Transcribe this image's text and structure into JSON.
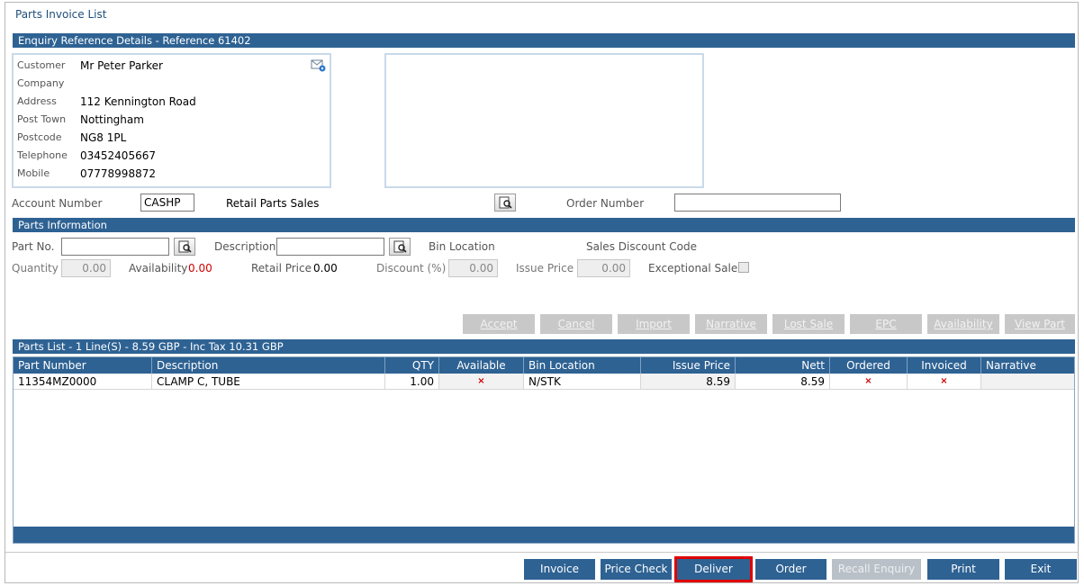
{
  "page": {
    "title": "Parts Invoice List"
  },
  "enquiry": {
    "bar_title": "Enquiry Reference Details  -  Reference 61402",
    "customer_label": "Customer",
    "customer": "Mr Peter Parker",
    "company_label": "Company",
    "company": "",
    "address_label": "Address",
    "address": "112 Kennington Road",
    "post_town_label": "Post Town",
    "post_town": "Nottingham",
    "postcode_label": "Postcode",
    "postcode": "NG8 1PL",
    "telephone_label": "Telephone",
    "telephone": "03452405667",
    "mobile_label": "Mobile",
    "mobile": "07778998872",
    "account_number_label": "Account Number",
    "account_number": "CASHP",
    "account_type": "Retail Parts Sales",
    "order_number_label": "Order Number",
    "order_number": ""
  },
  "parts_info": {
    "bar_title": "Parts Information",
    "part_no_label": "Part No.",
    "part_no": "",
    "description_label": "Description",
    "description": "",
    "bin_location_label": "Bin Location",
    "sales_discount_code_label": "Sales Discount Code",
    "quantity_label": "Quantity",
    "quantity": "0.00",
    "availability_label": "Availability",
    "availability": "0.00",
    "retail_price_label": "Retail Price",
    "retail_price": "0.00",
    "discount_label": "Discount (%)",
    "discount": "0.00",
    "issue_price_label": "Issue Price",
    "issue_price": "0.00",
    "exceptional_sale_label": "Exceptional Sale",
    "buttons": {
      "accept": "Accept",
      "cancel": "Cancel",
      "import": "Import",
      "narrative": "Narrative",
      "lost_sale": "Lost Sale",
      "epc": "EPC",
      "availability": "Availability",
      "view_part": "View Part"
    }
  },
  "parts_list": {
    "bar_title": "Parts List - 1 Line(S) - 8.59 GBP - Inc Tax 10.31 GBP",
    "columns": [
      "Part Number",
      "Description",
      "QTY",
      "Available",
      "Bin Location",
      "Issue Price",
      "Nett",
      "Ordered",
      "Invoiced",
      "Narrative"
    ],
    "rows": [
      {
        "part_number": "11354MZ0000",
        "description": "CLAMP C, TUBE",
        "qty": "1.00",
        "available": "×",
        "bin_location": "N/STK",
        "issue_price": "8.59",
        "nett": "8.59",
        "ordered": "×",
        "invoiced": "×",
        "narrative": ""
      }
    ]
  },
  "footer": {
    "invoice": "Invoice",
    "price_check": "Price Check",
    "deliver": "Deliver",
    "order": "Order",
    "recall_enquiry": "Recall Enquiry",
    "print": "Print",
    "exit": "Exit"
  },
  "colors": {
    "header_bar": "#2e6293",
    "availability_value": "#d00000",
    "highlight_outline": "#e00000"
  }
}
